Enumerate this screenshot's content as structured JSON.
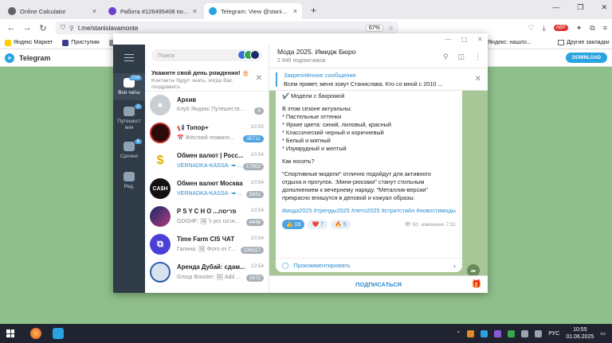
{
  "browser": {
    "tabs": [
      {
        "label": "Online Calculator",
        "color": "#5f6368",
        "active": false
      },
      {
        "label": "Работа #126495408 по заказу",
        "color": "#6b3fd1",
        "active": false
      },
      {
        "label": "Telegram: View @stanislavamor",
        "color": "#2aa3e1",
        "active": true
      }
    ],
    "url": "t.me/stanislavamonte",
    "zoom": "67%",
    "bookmarks": [
      "Яндекс Маркет",
      "Приступим",
      "Во"
    ],
    "bookmarks_right": [
      "Яндекс: нашло...",
      "Другие закладки"
    ]
  },
  "tg_web": {
    "brand": "Telegram",
    "download": "DOWNLOAD"
  },
  "rail": [
    {
      "label": "Все чаты",
      "badge": "709"
    },
    {
      "label": "Путешест вия",
      "badge": "2"
    },
    {
      "label": "Срочно",
      "badge": "6"
    },
    {
      "label": "Ред.",
      "badge": ""
    }
  ],
  "chatlist": {
    "search_placeholder": "Поиск",
    "birthday_title": "Укажите свой день рождения! 🎂",
    "birthday_sub": "Контакты будут знать, когда Вас поздравить",
    "chats": [
      {
        "name": "Архив",
        "preview": "Клуб Яндекс Путешествен...",
        "time": "",
        "count": "8",
        "color": "#c9ced3",
        "avatar": "",
        "blue": false
      },
      {
        "name": "📢 Топор+",
        "preview": "📅 Жёсткий геомаги...",
        "time": "10:55",
        "count": "35711",
        "color": "#2b0a0a",
        "avatar": "",
        "blue": true
      },
      {
        "name": "Обмен валют | Росс...",
        "preview": "VERNADKA-KASSA: ➡ ...",
        "time": "10:54",
        "count": "17902",
        "color": "#f5c400",
        "avatar": "$",
        "blue": false
      },
      {
        "name": "Обмен валют Москва",
        "preview": "VERNADKA-KASSA: ➡ ...",
        "time": "10:54",
        "count": "1641",
        "color": "#111",
        "avatar": "CA$H",
        "blue": false
      },
      {
        "name": "P S Y C H O ...פריסה",
        "preview": "GDGHF: 🖼 ארגנו כאן ל...",
        "time": "10:54",
        "count": "4448",
        "color": "#1b2a6b",
        "avatar": "",
        "blue": false
      },
      {
        "name": "Time Farm CIS ЧАТ",
        "preview": "Галина: 🖼 Фото от Г...",
        "time": "10:54",
        "count": "138117",
        "color": "#4a3fd6",
        "avatar": "⧉",
        "blue": false
      },
      {
        "name": "Аренда Дубай: сдам...",
        "preview": "Group Booster: 🖼 Add ...",
        "time": "10:54",
        "count": "1672",
        "color": "#d9e3f0",
        "avatar": "",
        "blue": false
      }
    ]
  },
  "channel": {
    "title": "Мода 2025. Имидж Бюро",
    "subscribers": "2 846 подписчиков",
    "pinned_title": "Закреплённое сообщение",
    "pinned_text": "Всем привет, меня зовут Станислава.  Кто со мной с 2010 ...",
    "message_lines": [
      "✔️ Модели с бахромой",
      "",
      "В этом сезоне актуальны:",
      "* Пастельные оттенки",
      "* Яркие цвета: синий, лиловый, красный",
      "* Классический черный и коричневый",
      "* Белый и мятный",
      "* Изумрудный и желтый",
      "",
      "Как носить?",
      "",
      "\"Спортивные модели\" отлично подойдут для активного",
      "отдыха и прогулок. :Мини-рюкзаки\" станут стильным",
      "дополнением к вечернему наряду. \"Металлик-версии\"",
      "прекрасно впишутся в деловой и кэжуал образы."
    ],
    "hashtags": "#мода2025 #тренды2025 #лето2025 #стритстайл #новостимоды",
    "reactions": [
      {
        "emoji": "👍",
        "count": "16",
        "selected": true
      },
      {
        "emoji": "❤️",
        "count": "7",
        "selected": false
      },
      {
        "emoji": "🔥",
        "count": "5",
        "selected": false
      }
    ],
    "views": "50",
    "edited_time": "изменено 7:31",
    "comment": "Прокомментировать",
    "subscribe": "ПОДПИСАТЬСЯ"
  },
  "taskbar": {
    "lang": "РУС",
    "time": "10:55",
    "date": "01.06.2025"
  }
}
